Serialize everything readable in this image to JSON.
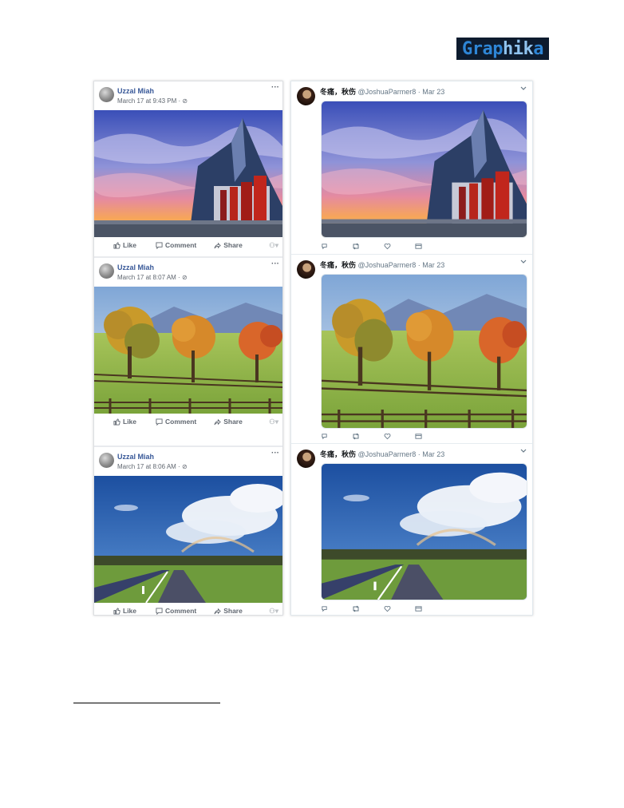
{
  "logo": {
    "text_a": "Grap",
    "text_b": "hik",
    "text_c": "a"
  },
  "facebook": {
    "actions": {
      "like": "Like",
      "comment": "Comment",
      "share": "Share"
    },
    "posts": [
      {
        "author": "Uzzal Miah",
        "date": "March 17 at 9:43 PM · ",
        "image": "modern-building-sunset"
      },
      {
        "author": "Uzzal Miah",
        "date": "March 17 at 8:07 AM · ",
        "image": "autumn-trees-pasture"
      },
      {
        "author": "Uzzal Miah",
        "date": "March 17 at 8:06 AM · ",
        "image": "road-rainbow-sky"
      }
    ]
  },
  "twitter": {
    "posts": [
      {
        "name": "冬痛，秋伤",
        "handle": "@JoshuaParmer8 · Mar 23",
        "image": "modern-building-sunset"
      },
      {
        "name": "冬痛，秋伤",
        "handle": "@JoshuaParmer8 · Mar 23",
        "image": "autumn-trees-pasture"
      },
      {
        "name": "冬痛，秋伤",
        "handle": "@JoshuaParmer8 · Mar 23",
        "image": "road-rainbow-sky"
      }
    ]
  }
}
